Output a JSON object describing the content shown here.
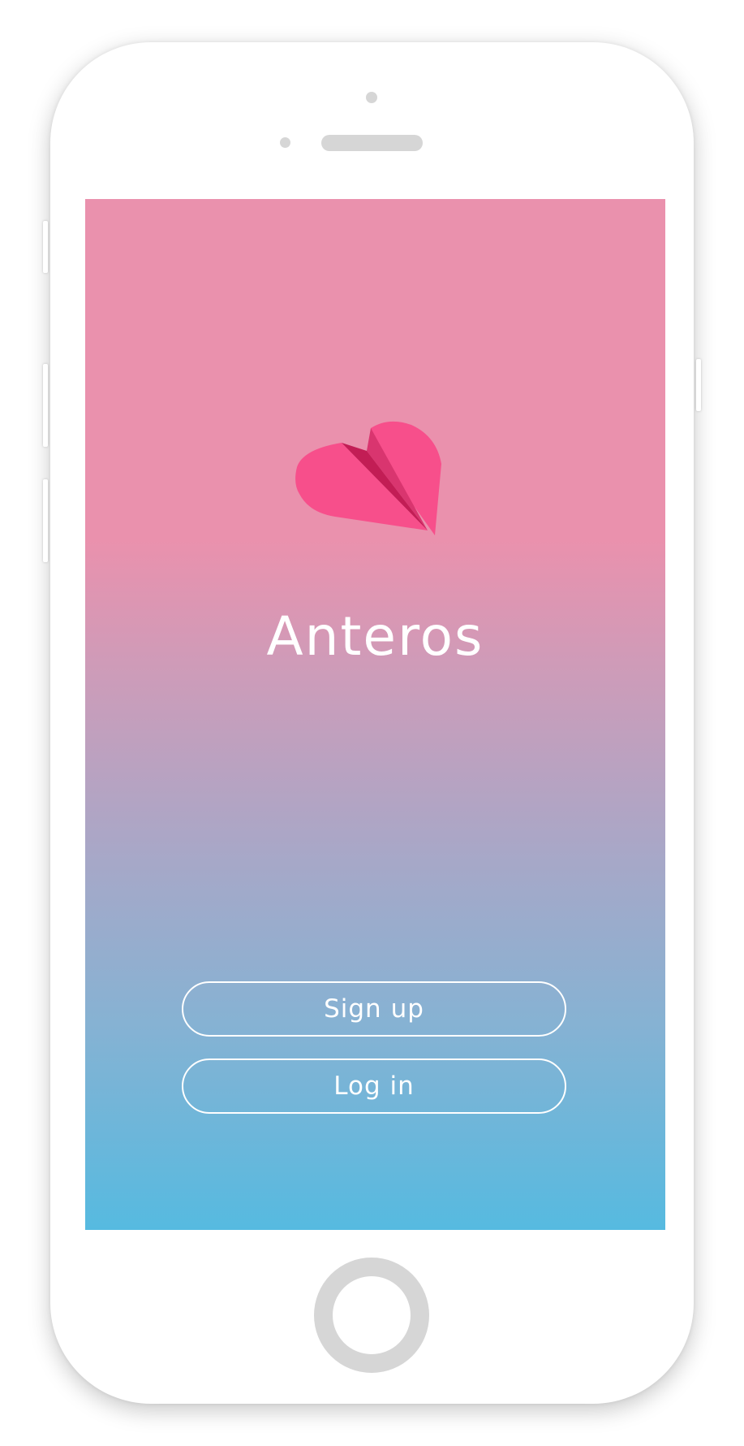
{
  "app": {
    "name": "Anteros"
  },
  "logo": {
    "icon": "origami-heart-icon",
    "colors": {
      "primary": "#f74f8b",
      "mid": "#d9356f",
      "dark": "#c21d55"
    }
  },
  "actions": {
    "signup_label": "Sign up",
    "login_label": "Log in"
  },
  "theme": {
    "gradient_top": "#ea91ad",
    "gradient_bottom": "#56bae0",
    "button_border": "#ffffff",
    "device_detail": "#d6d6d6"
  }
}
